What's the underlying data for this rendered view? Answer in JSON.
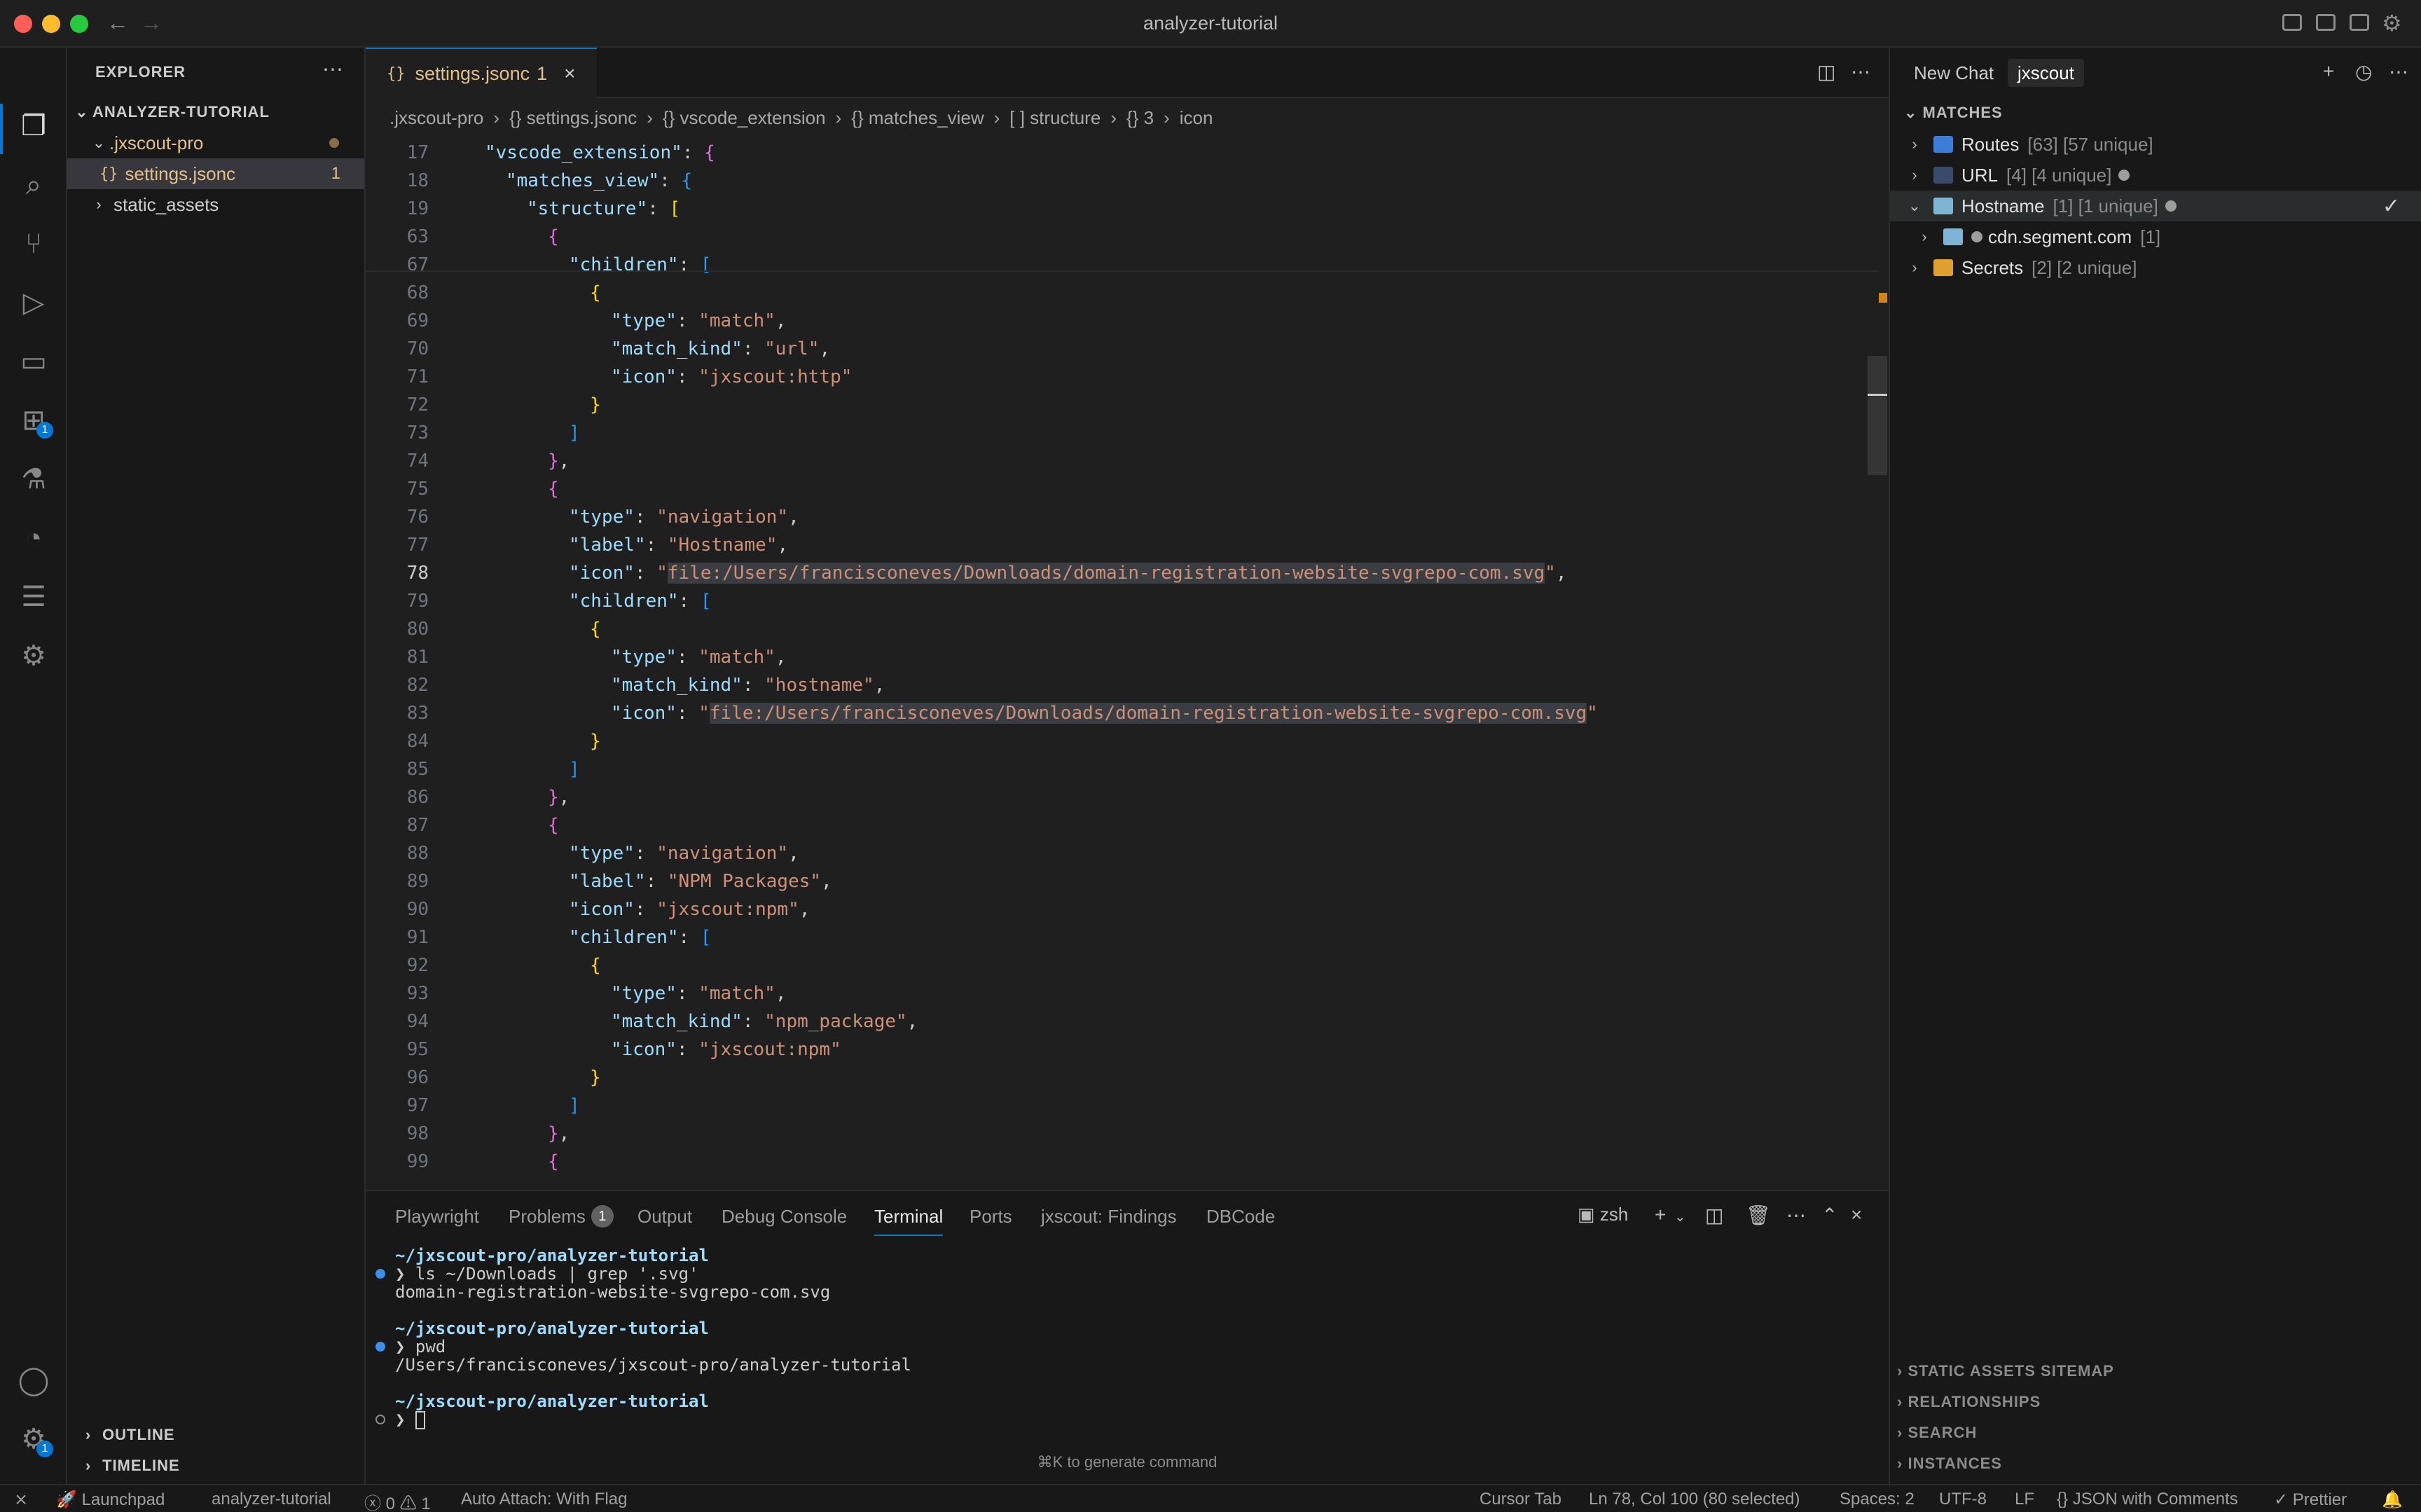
{
  "window": {
    "title": "analyzer-tutorial"
  },
  "sidebar": {
    "title": "EXPLORER",
    "root": "ANALYZER-TUTORIAL",
    "items": [
      {
        "label": ".jxscout-pro"
      },
      {
        "label": "settings.jsonc",
        "count": "1"
      },
      {
        "label": "static_assets"
      }
    ],
    "outline": "OUTLINE",
    "timeline": "TIMELINE"
  },
  "activity": {
    "extensions_badge": "1",
    "settings_badge": "1"
  },
  "editor": {
    "tab": {
      "label": "settings.jsonc",
      "problems": "1"
    },
    "breadcrumb": [
      ".jxscout-pro",
      "{} settings.jsonc",
      "{} vscode_extension",
      "{} matches_view",
      "[ ] structure",
      "{} 3",
      "icon"
    ],
    "lines": [
      {
        "n": "17",
        "i": 0,
        "t": [
          [
            "k",
            "\"vscode_extension\""
          ],
          [
            "p",
            ": "
          ],
          [
            "b1",
            "{"
          ]
        ]
      },
      {
        "n": "18",
        "i": 1,
        "t": [
          [
            "k",
            "\"matches_view\""
          ],
          [
            "p",
            ": "
          ],
          [
            "b2",
            "{"
          ]
        ]
      },
      {
        "n": "19",
        "i": 2,
        "t": [
          [
            "k",
            "\"structure\""
          ],
          [
            "p",
            ": "
          ],
          [
            "b3",
            "["
          ]
        ]
      },
      {
        "n": "63",
        "i": 3,
        "t": [
          [
            "b1",
            "{"
          ]
        ]
      },
      {
        "n": "67",
        "i": 4,
        "t": [
          [
            "k",
            "\"children\""
          ],
          [
            "p",
            ": "
          ],
          [
            "b2",
            "["
          ]
        ]
      },
      {
        "n": "68",
        "i": 5,
        "t": [
          [
            "b3",
            "{"
          ]
        ]
      },
      {
        "n": "69",
        "i": 6,
        "t": [
          [
            "k",
            "\"type\""
          ],
          [
            "p",
            ": "
          ],
          [
            "s",
            "\"match\""
          ],
          [
            "p",
            ","
          ]
        ]
      },
      {
        "n": "70",
        "i": 6,
        "t": [
          [
            "k",
            "\"match_kind\""
          ],
          [
            "p",
            ": "
          ],
          [
            "s",
            "\"url\""
          ],
          [
            "p",
            ","
          ]
        ]
      },
      {
        "n": "71",
        "i": 6,
        "t": [
          [
            "k",
            "\"icon\""
          ],
          [
            "p",
            ": "
          ],
          [
            "s",
            "\"jxscout:http\""
          ]
        ]
      },
      {
        "n": "72",
        "i": 5,
        "t": [
          [
            "b3",
            "}"
          ]
        ]
      },
      {
        "n": "73",
        "i": 4,
        "t": [
          [
            "b2",
            "]"
          ]
        ]
      },
      {
        "n": "74",
        "i": 3,
        "t": [
          [
            "b1",
            "}"
          ],
          [
            "p",
            ","
          ]
        ]
      },
      {
        "n": "75",
        "i": 3,
        "t": [
          [
            "b1",
            "{"
          ]
        ]
      },
      {
        "n": "76",
        "i": 4,
        "t": [
          [
            "k",
            "\"type\""
          ],
          [
            "p",
            ": "
          ],
          [
            "s",
            "\"navigation\""
          ],
          [
            "p",
            ","
          ]
        ]
      },
      {
        "n": "77",
        "i": 4,
        "t": [
          [
            "k",
            "\"label\""
          ],
          [
            "p",
            ": "
          ],
          [
            "s",
            "\"Hostname\""
          ],
          [
            "p",
            ","
          ]
        ]
      },
      {
        "n": "78",
        "i": 4,
        "cur": true,
        "t": [
          [
            "k",
            "\"icon\""
          ],
          [
            "p",
            ": "
          ],
          [
            "s",
            "\""
          ],
          [
            "s hl",
            "file:/Users/francisconeves/Downloads/domain-registration-website-svgrepo-com.svg"
          ],
          [
            "s",
            "\""
          ],
          [
            "p",
            ","
          ]
        ]
      },
      {
        "n": "79",
        "i": 4,
        "t": [
          [
            "k",
            "\"children\""
          ],
          [
            "p",
            ": "
          ],
          [
            "b2",
            "["
          ]
        ]
      },
      {
        "n": "80",
        "i": 5,
        "t": [
          [
            "b3",
            "{"
          ]
        ]
      },
      {
        "n": "81",
        "i": 6,
        "t": [
          [
            "k",
            "\"type\""
          ],
          [
            "p",
            ": "
          ],
          [
            "s",
            "\"match\""
          ],
          [
            "p",
            ","
          ]
        ]
      },
      {
        "n": "82",
        "i": 6,
        "t": [
          [
            "k",
            "\"match_kind\""
          ],
          [
            "p",
            ": "
          ],
          [
            "s",
            "\"hostname\""
          ],
          [
            "p",
            ","
          ]
        ]
      },
      {
        "n": "83",
        "i": 6,
        "t": [
          [
            "k",
            "\"icon\""
          ],
          [
            "p",
            ": "
          ],
          [
            "s",
            "\""
          ],
          [
            "s hl",
            "file:/Users/francisconeves/Downloads/domain-registration-website-svgrepo-com.svg"
          ],
          [
            "s",
            "\""
          ]
        ]
      },
      {
        "n": "84",
        "i": 5,
        "t": [
          [
            "b3",
            "}"
          ]
        ]
      },
      {
        "n": "85",
        "i": 4,
        "t": [
          [
            "b2",
            "]"
          ]
        ]
      },
      {
        "n": "86",
        "i": 3,
        "t": [
          [
            "b1",
            "}"
          ],
          [
            "p",
            ","
          ]
        ]
      },
      {
        "n": "87",
        "i": 3,
        "t": [
          [
            "b1",
            "{"
          ]
        ]
      },
      {
        "n": "88",
        "i": 4,
        "t": [
          [
            "k",
            "\"type\""
          ],
          [
            "p",
            ": "
          ],
          [
            "s",
            "\"navigation\""
          ],
          [
            "p",
            ","
          ]
        ]
      },
      {
        "n": "89",
        "i": 4,
        "t": [
          [
            "k",
            "\"label\""
          ],
          [
            "p",
            ": "
          ],
          [
            "s",
            "\"NPM Packages\""
          ],
          [
            "p",
            ","
          ]
        ]
      },
      {
        "n": "90",
        "i": 4,
        "t": [
          [
            "k",
            "\"icon\""
          ],
          [
            "p",
            ": "
          ],
          [
            "s",
            "\"jxscout:npm\""
          ],
          [
            "p",
            ","
          ]
        ]
      },
      {
        "n": "91",
        "i": 4,
        "t": [
          [
            "k",
            "\"children\""
          ],
          [
            "p",
            ": "
          ],
          [
            "b2",
            "["
          ]
        ]
      },
      {
        "n": "92",
        "i": 5,
        "t": [
          [
            "b3",
            "{"
          ]
        ]
      },
      {
        "n": "93",
        "i": 6,
        "t": [
          [
            "k",
            "\"type\""
          ],
          [
            "p",
            ": "
          ],
          [
            "s",
            "\"match\""
          ],
          [
            "p",
            ","
          ]
        ]
      },
      {
        "n": "94",
        "i": 6,
        "t": [
          [
            "k",
            "\"match_kind\""
          ],
          [
            "p",
            ": "
          ],
          [
            "s",
            "\"npm_package\""
          ],
          [
            "p",
            ","
          ]
        ]
      },
      {
        "n": "95",
        "i": 6,
        "t": [
          [
            "k",
            "\"icon\""
          ],
          [
            "p",
            ": "
          ],
          [
            "s",
            "\"jxscout:npm\""
          ]
        ]
      },
      {
        "n": "96",
        "i": 5,
        "t": [
          [
            "b3",
            "}"
          ]
        ]
      },
      {
        "n": "97",
        "i": 4,
        "t": [
          [
            "b2",
            "]"
          ]
        ]
      },
      {
        "n": "98",
        "i": 3,
        "t": [
          [
            "b1",
            "}"
          ],
          [
            "p",
            ","
          ]
        ]
      },
      {
        "n": "99",
        "i": 3,
        "t": [
          [
            "b1",
            "{"
          ]
        ]
      }
    ]
  },
  "panel": {
    "tabs": [
      "Playwright",
      "Problems",
      "Output",
      "Debug Console",
      "Terminal",
      "Ports",
      "jxscout: Findings",
      "DBCode"
    ],
    "problems_badge": "1",
    "shell": "zsh",
    "terminal": [
      {
        "cls": "term-path",
        "text": "~/jxscout-pro/analyzer-tutorial"
      },
      {
        "cls": "cmd",
        "text": "❯ ls ~/Downloads | grep '.svg'"
      },
      {
        "cls": "out",
        "text": "domain-registration-website-svgrepo-com.svg"
      },
      {
        "cls": "term-path",
        "text": "~/jxscout-pro/analyzer-tutorial"
      },
      {
        "cls": "cmd",
        "text": "❯ pwd"
      },
      {
        "cls": "out",
        "text": "/Users/francisconeves/jxscout-pro/analyzer-tutorial"
      },
      {
        "cls": "term-path",
        "text": "~/jxscout-pro/analyzer-tutorial"
      },
      {
        "cls": "prompt",
        "text": "❯ "
      }
    ],
    "hint": "⌘K to generate command"
  },
  "rpanel": {
    "tabs": [
      "New Chat",
      "jxscout"
    ],
    "matches_title": "MATCHES",
    "rows": [
      {
        "name": "Routes",
        "meta": "[63] [57 unique]",
        "color": "#3c7dd9",
        "chev": "›"
      },
      {
        "name": "URL",
        "meta": "[4] [4 unique]",
        "color": "#3a4a6a",
        "chev": "›",
        "dot": true
      },
      {
        "name": "Hostname",
        "meta": "[1] [1 unique]",
        "color": "#7fb4d4",
        "chev": "⌄",
        "dot": true,
        "selected": true
      },
      {
        "name": "cdn.segment.com",
        "meta": "[1]",
        "color": "#7fb4d4",
        "chev": "›",
        "child": true
      },
      {
        "name": "Secrets",
        "meta": "[2] [2 unique]",
        "color": "#e0a030",
        "chev": "›"
      }
    ],
    "footer": [
      "STATIC ASSETS SITEMAP",
      "RELATIONSHIPS",
      "SEARCH",
      "INSTANCES"
    ]
  },
  "status": {
    "launchpad": "Launchpad",
    "workspace": "analyzer-tutorial",
    "errors": "0",
    "warnings": "1",
    "auto_attach": "Auto Attach: With Flag",
    "cursor_tab": "Cursor Tab",
    "position": "Ln 78, Col 100 (80 selected)",
    "spaces": "Spaces: 2",
    "encoding": "UTF-8",
    "eol": "LF",
    "language": "JSON with Comments",
    "formatter": "Prettier"
  }
}
